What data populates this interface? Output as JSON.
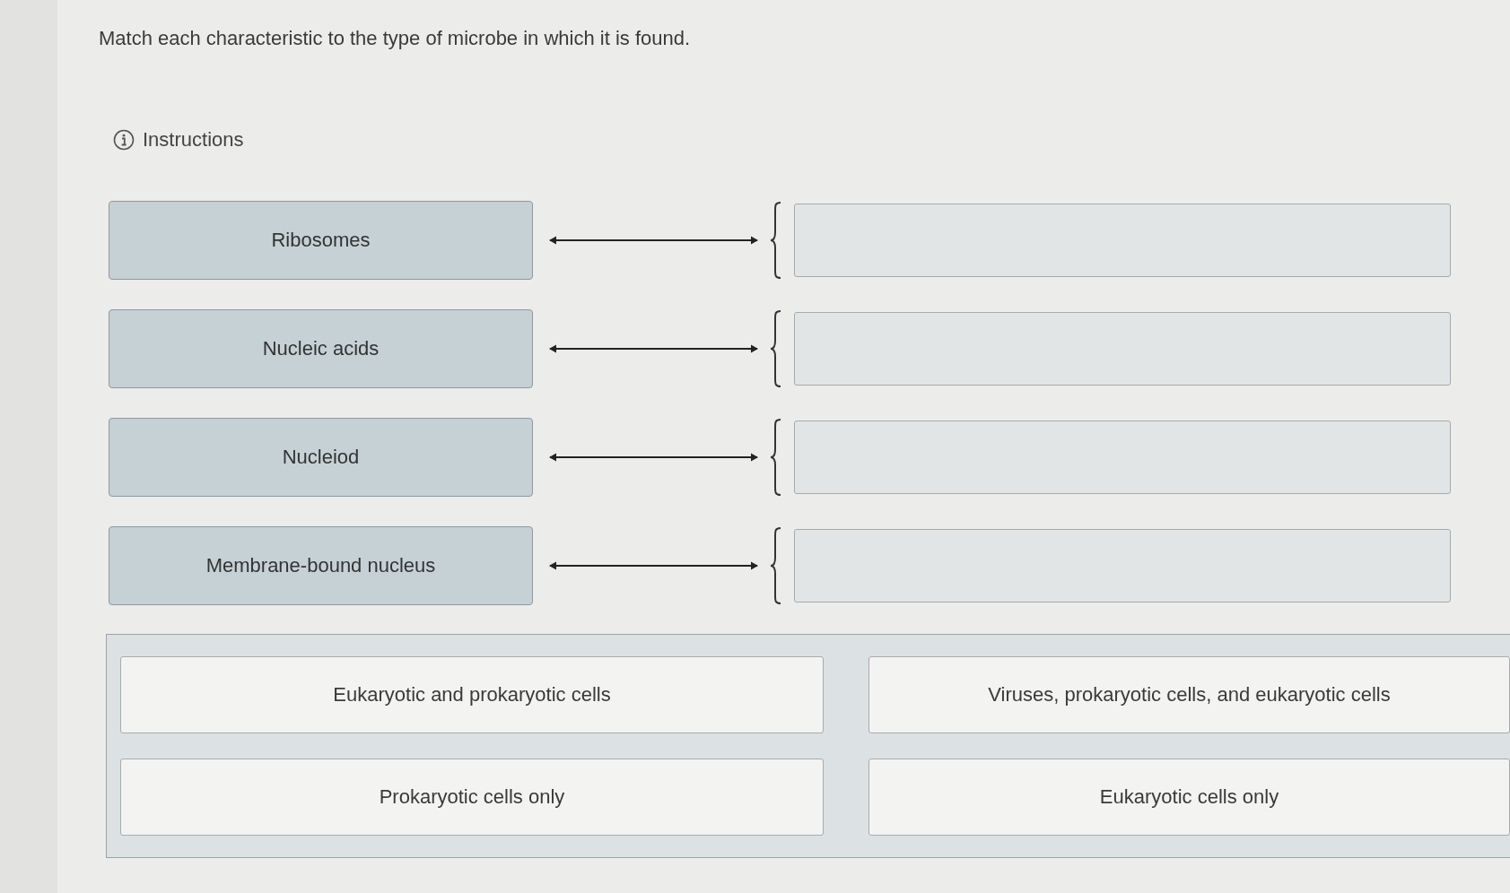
{
  "prompt": "Match each characteristic to the type of microbe in which it is found.",
  "instructions": {
    "label": "Instructions"
  },
  "items": [
    {
      "label": "Ribosomes"
    },
    {
      "label": "Nucleic acids"
    },
    {
      "label": "Nucleiod"
    },
    {
      "label": "Membrane-bound nucleus"
    }
  ],
  "answer_bank": [
    "Eukaryotic and prokaryotic cells",
    "Viruses, prokaryotic cells, and eukaryotic cells",
    "Prokaryotic cells only",
    "Eukaryotic cells only"
  ]
}
